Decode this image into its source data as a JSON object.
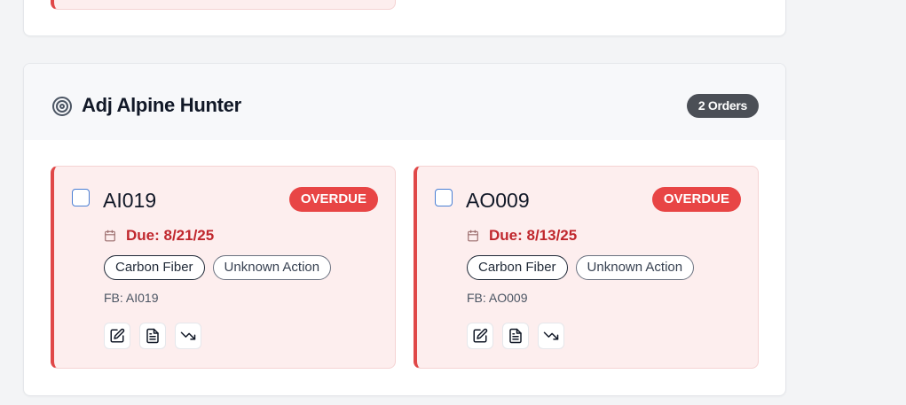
{
  "group": {
    "title": "Adj Alpine Hunter",
    "icon": "target-icon",
    "order_count": "2 Orders"
  },
  "orders": [
    {
      "id": "AI019",
      "status": "OVERDUE",
      "due": "Due: 8/21/25",
      "tags": [
        "Carbon Fiber",
        "Unknown Action"
      ],
      "fb": "FB: AI019",
      "actions": [
        "edit-icon",
        "document-icon",
        "trend-down-icon"
      ]
    },
    {
      "id": "AO009",
      "status": "OVERDUE",
      "due": "Due: 8/13/25",
      "tags": [
        "Carbon Fiber",
        "Unknown Action"
      ],
      "fb": "FB: AO009",
      "actions": [
        "edit-icon",
        "document-icon",
        "trend-down-icon"
      ]
    }
  ],
  "colors": {
    "accent_red": "#e04848",
    "status_red": "#e84545",
    "due_text": "#c0272d",
    "checkbox_blue": "#4a7fd4",
    "badge_dark": "#4b4f56"
  }
}
